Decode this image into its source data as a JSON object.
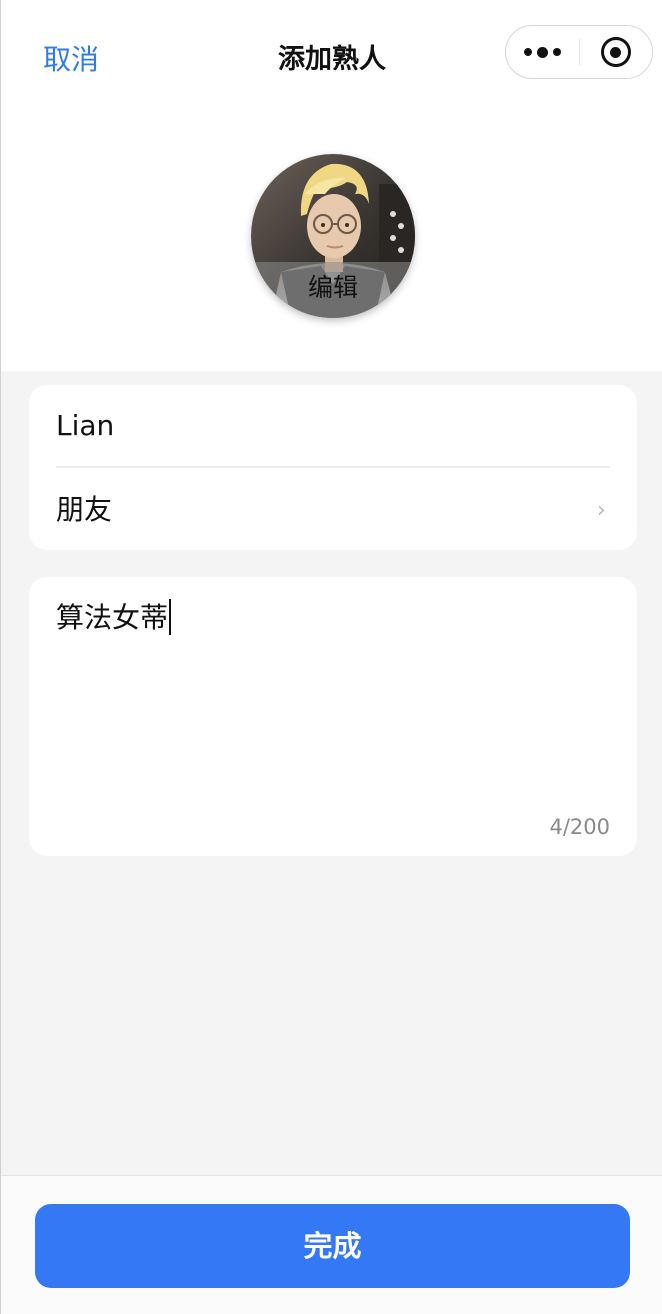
{
  "header": {
    "cancel_label": "取消",
    "title": "添加熟人",
    "capsule": {
      "more_icon": "more-dots-icon",
      "close_icon": "target-circle-icon"
    }
  },
  "avatar": {
    "edit_label": "编辑"
  },
  "form": {
    "name_value": "Lian",
    "relation_value": "朋友",
    "relation_chevron": "›",
    "note_value": "算法女蒂",
    "note_counter": "4/200"
  },
  "footer": {
    "done_label": "完成"
  },
  "colors": {
    "accent": "#3478f6",
    "link": "#2f7bea",
    "background": "#f4f4f4"
  }
}
